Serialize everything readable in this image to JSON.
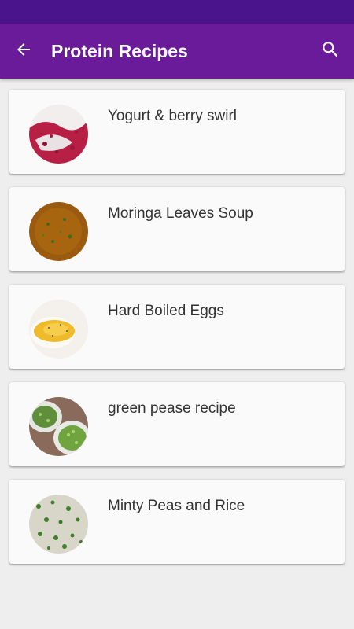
{
  "app_bar": {
    "title": "Protein Recipes",
    "back_icon": "arrow-left-icon",
    "search_icon": "search-icon",
    "color": "#6a1b9a",
    "status_bar_color": "#4a148c"
  },
  "recipes": [
    {
      "title": "Yogurt & berry swirl"
    },
    {
      "title": "Moringa Leaves Soup"
    },
    {
      "title": "Hard Boiled Eggs"
    },
    {
      "title": "green pease recipe"
    },
    {
      "title": "Minty Peas and Rice"
    }
  ]
}
